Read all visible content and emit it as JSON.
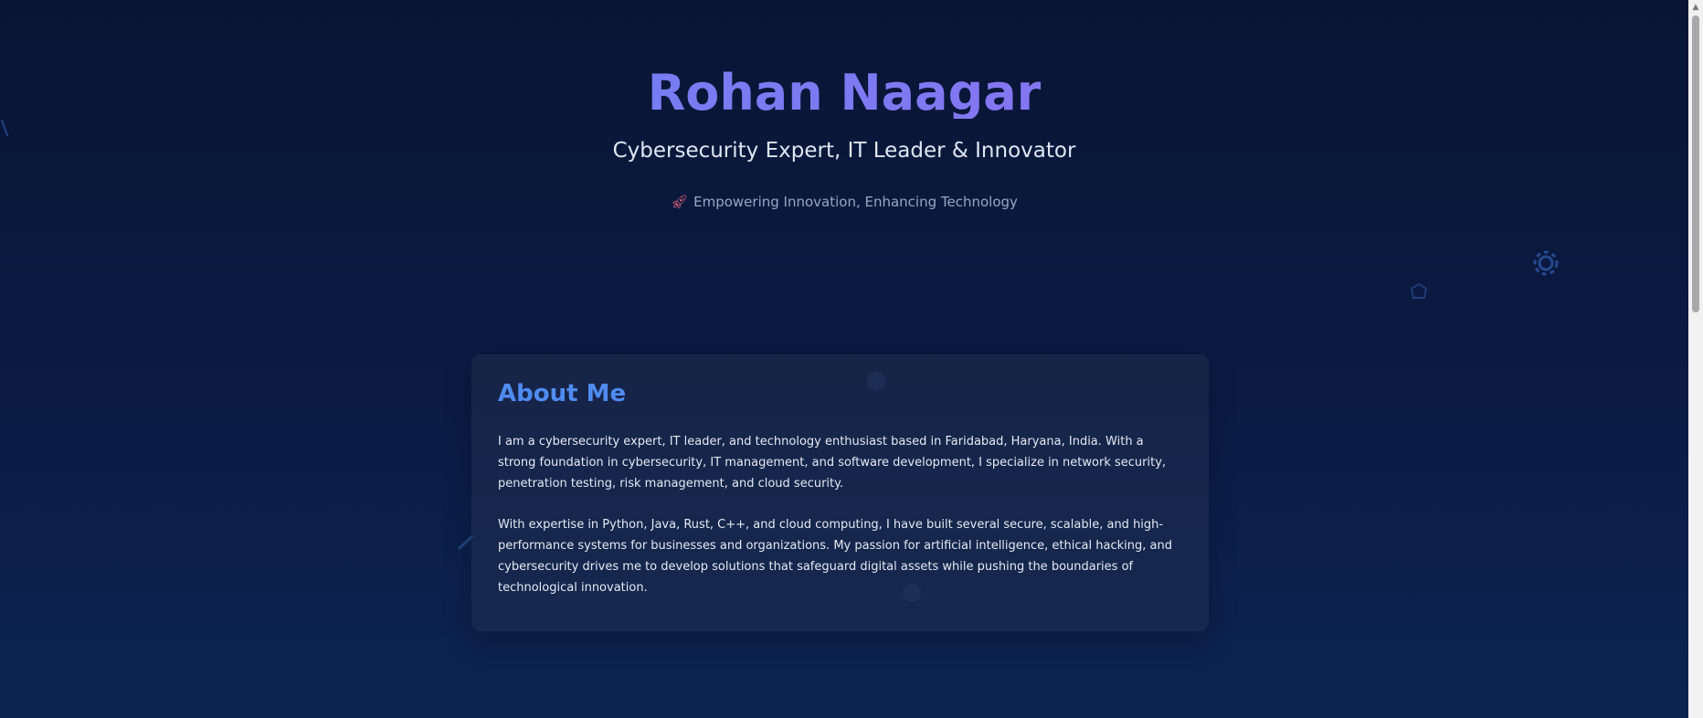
{
  "hero": {
    "name": "Rohan Naagar",
    "subtitle": "Cybersecurity Expert, IT Leader & Innovator",
    "tagline_icon": "rocket-icon",
    "tagline": "Empowering Innovation, Enhancing Technology"
  },
  "about": {
    "title": "About Me",
    "paragraphs": [
      "I am a cybersecurity expert, IT leader, and technology enthusiast based in Faridabad, Haryana, India. With a strong foundation in cybersecurity, IT management, and software development, I specialize in network security, penetration testing, risk management, and cloud security.",
      "With expertise in Python, Java, Rust, C++, and cloud computing, I have built several secure, scalable, and high-performance systems for businesses and organizations. My passion for artificial intelligence, ethical hacking, and cybersecurity drives me to develop solutions that safeguard digital assets while pushing the boundaries of technological innovation."
    ]
  },
  "colors": {
    "background_top": "#0a1535",
    "background_bottom": "#0c2452",
    "accent_blue": "#4f8bf0",
    "title_gradient_start": "#5f86f0",
    "title_gradient_end": "#9b6cf2"
  },
  "decorative_icons": [
    "gear-icon",
    "shield-icon",
    "circle-icon",
    "link-icon"
  ]
}
